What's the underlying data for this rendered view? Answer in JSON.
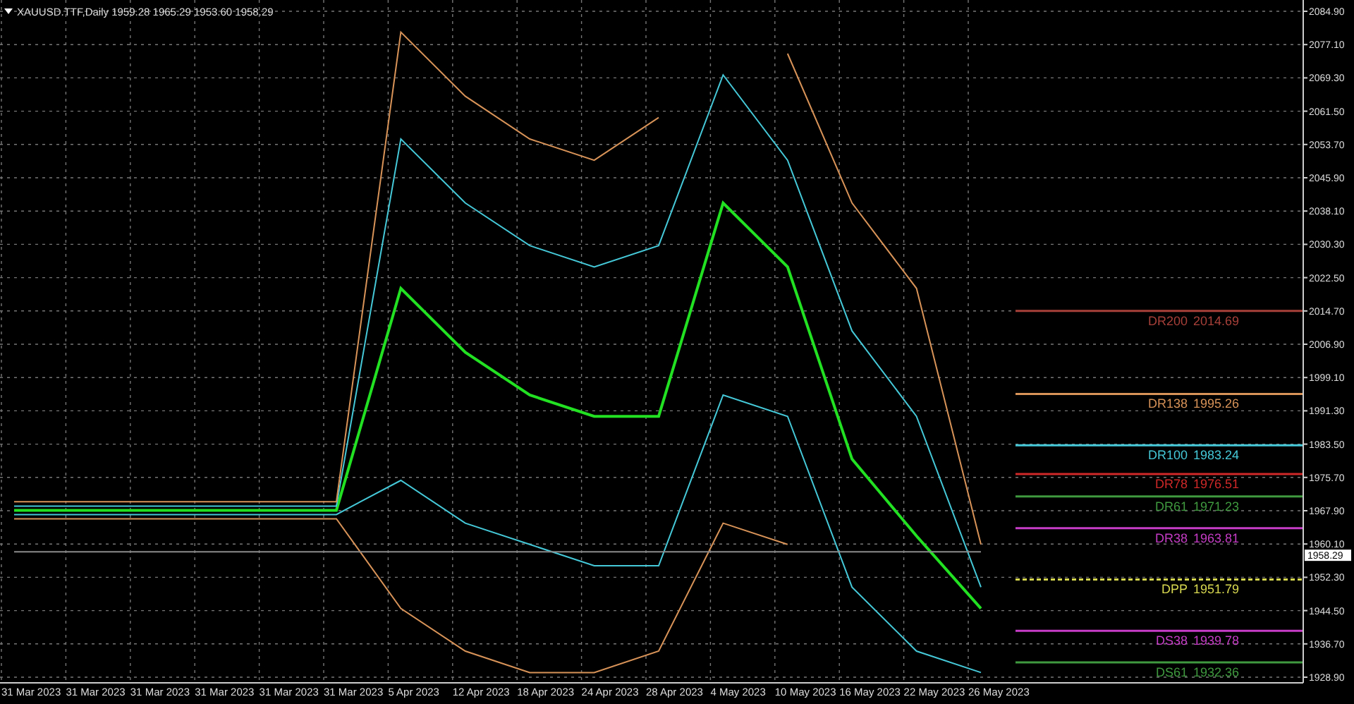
{
  "title": "XAUUSD.TTF,Daily  1959.28 1965.29 1953.60 1958.29",
  "price_tag": "1958.29",
  "levels": [
    {
      "name": "DR200",
      "value": "2014.69",
      "color": "#a8403a",
      "dashed": false
    },
    {
      "name": "DR138",
      "value": "1995.26",
      "color": "#d89358",
      "dashed": false
    },
    {
      "name": "DR100",
      "value": "1983.24",
      "color": "#45c8d8",
      "dashed": false
    },
    {
      "name": "DR78",
      "value": "1976.51",
      "color": "#d02828",
      "dashed": false
    },
    {
      "name": "DR61",
      "value": "1971.23",
      "color": "#3f9a3f",
      "dashed": false
    },
    {
      "name": "DR38",
      "value": "1963.81",
      "color": "#c63cc6",
      "dashed": false
    },
    {
      "name": "DPP",
      "value": "1951.79",
      "color": "#d8d850",
      "dashed": true
    },
    {
      "name": "DS38",
      "value": "1939.78",
      "color": "#c63cc6",
      "dashed": false
    },
    {
      "name": "DS61",
      "value": "1932.36",
      "color": "#3f9a3f",
      "dashed": false
    }
  ],
  "chart_data": {
    "type": "line",
    "grid": true,
    "categories": [
      "31 Mar 2023",
      "31 Mar 2023",
      "31 Mar 2023",
      "31 Mar 2023",
      "31 Mar 2023",
      "31 Mar 2023",
      "5 Apr 2023",
      "12 Apr 2023",
      "18 Apr 2023",
      "24 Apr 2023",
      "28 Apr 2023",
      "4 May 2023",
      "10 May 2023",
      "16 May 2023",
      "22 May 2023",
      "26 May 2023"
    ],
    "ylim": [
      1928.9,
      2084.9
    ],
    "yticks": [
      {
        "value": 2084.9,
        "label": "2084.90"
      },
      {
        "value": 2077.1,
        "label": "2077.10"
      },
      {
        "value": 2069.3,
        "label": "2069.30"
      },
      {
        "value": 2061.5,
        "label": "2061.50"
      },
      {
        "value": 2053.7,
        "label": "2053.70"
      },
      {
        "value": 2045.9,
        "label": "2045.90"
      },
      {
        "value": 2038.1,
        "label": "2038.10"
      },
      {
        "value": 2030.3,
        "label": "2030.30"
      },
      {
        "value": 2022.5,
        "label": "2022.50"
      },
      {
        "value": 2014.7,
        "label": "2014.70"
      },
      {
        "value": 2006.9,
        "label": "2006.90"
      },
      {
        "value": 1999.1,
        "label": "1999.10"
      },
      {
        "value": 1991.3,
        "label": "1991.30"
      },
      {
        "value": 1983.5,
        "label": "1983.50"
      },
      {
        "value": 1975.7,
        "label": "1975.70"
      },
      {
        "value": 1967.9,
        "label": "1967.90"
      },
      {
        "value": 1960.1,
        "label": "1960.10"
      },
      {
        "value": 1952.3,
        "label": "1952.30"
      },
      {
        "value": 1944.5,
        "label": "1944.50"
      },
      {
        "value": 1936.7,
        "label": "1936.70"
      },
      {
        "value": 1928.9,
        "label": "1928.90"
      }
    ],
    "series": [
      {
        "color": "#22e022",
        "values": [
          1968,
          1968,
          1968,
          1968,
          1968,
          1968,
          2020,
          2005,
          1995,
          1990,
          1990,
          2040,
          2025,
          1980,
          1962,
          1945
        ]
      },
      {
        "color": "#45c8d8",
        "values": [
          1969,
          1969,
          1969,
          1969,
          1969,
          1969,
          2055,
          2040,
          2030,
          2025,
          2030,
          2070,
          2050,
          2010,
          1990,
          1950
        ]
      },
      {
        "color": "#45c8d8",
        "values": [
          1967,
          1967,
          1967,
          1967,
          1967,
          1967,
          1975,
          1965,
          1960,
          1955,
          1955,
          1995,
          1990,
          1950,
          1935,
          1930
        ]
      },
      {
        "color": "#d89358",
        "values": [
          1970,
          1970,
          1970,
          1970,
          1970,
          1970,
          2080,
          2065,
          2055,
          2050,
          2060,
          null,
          2075,
          2040,
          2020,
          1960
        ]
      },
      {
        "color": "#d89358",
        "values": [
          1966,
          1966,
          1966,
          1966,
          1966,
          1966,
          1945,
          1935,
          1930,
          1930,
          1935,
          1965,
          1960,
          null,
          null,
          null
        ]
      },
      {
        "color": "#8a8a8a",
        "values": [
          1958.29,
          1958.29,
          1958.29,
          1958.29,
          1958.29,
          1958.29,
          1958.29,
          1958.29,
          1958.29,
          1958.29,
          1958.29,
          1958.29,
          1958.29,
          1958.29,
          1958.29,
          1958.29
        ]
      }
    ]
  }
}
